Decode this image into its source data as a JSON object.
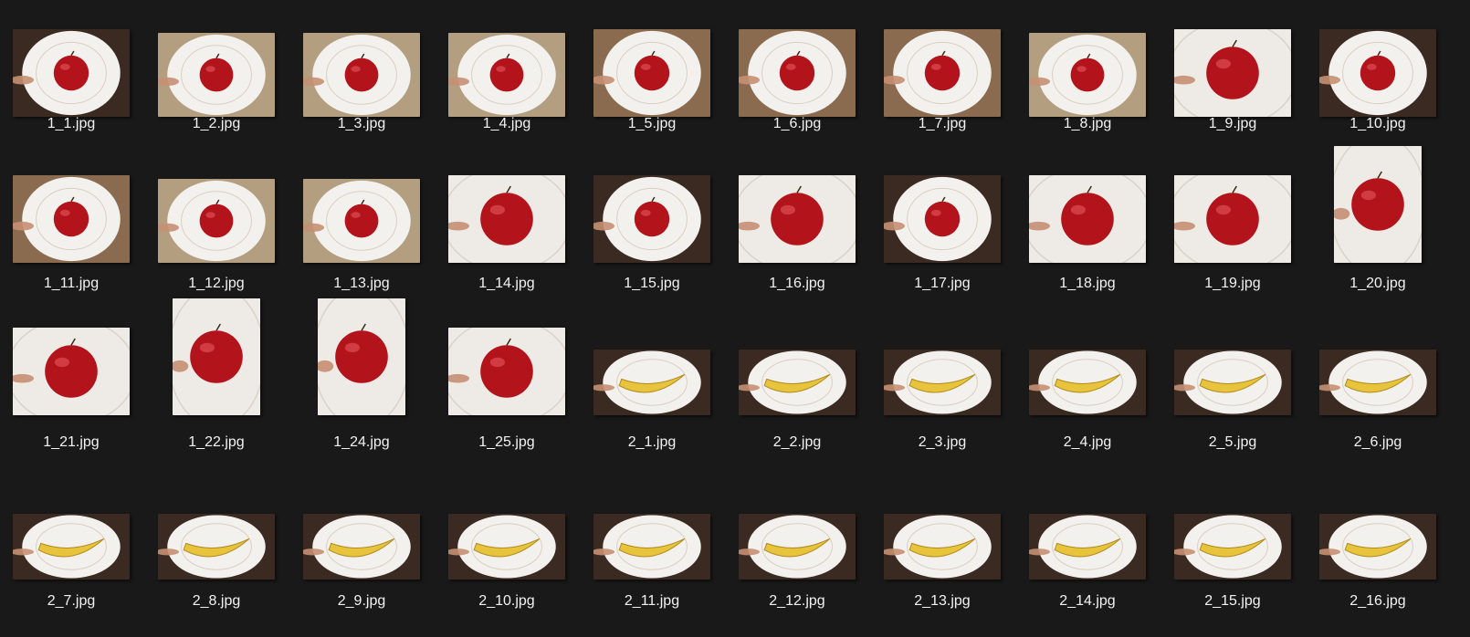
{
  "explorer": {
    "items": [
      {
        "name": "1_1.jpg",
        "subject": "apple",
        "scene": "dark-plate",
        "orientation": "landscape"
      },
      {
        "name": "1_2.jpg",
        "subject": "apple",
        "scene": "plate-on-granite",
        "orientation": "landscape"
      },
      {
        "name": "1_3.jpg",
        "subject": "apple",
        "scene": "plate-on-granite",
        "orientation": "landscape"
      },
      {
        "name": "1_4.jpg",
        "subject": "apple",
        "scene": "plate-on-granite",
        "orientation": "landscape"
      },
      {
        "name": "1_5.jpg",
        "subject": "apple",
        "scene": "plate-on-wood",
        "orientation": "landscape"
      },
      {
        "name": "1_6.jpg",
        "subject": "apple",
        "scene": "plate-on-wood",
        "orientation": "landscape"
      },
      {
        "name": "1_7.jpg",
        "subject": "apple",
        "scene": "plate-on-wood",
        "orientation": "landscape"
      },
      {
        "name": "1_8.jpg",
        "subject": "apple",
        "scene": "plate-on-granite",
        "orientation": "landscape"
      },
      {
        "name": "1_9.jpg",
        "subject": "apple",
        "scene": "plate-close",
        "orientation": "landscape"
      },
      {
        "name": "1_10.jpg",
        "subject": "apple",
        "scene": "dark-plate",
        "orientation": "landscape"
      },
      {
        "name": "1_11.jpg",
        "subject": "apple",
        "scene": "plate-on-wood",
        "orientation": "landscape"
      },
      {
        "name": "1_12.jpg",
        "subject": "apple",
        "scene": "plate-on-granite",
        "orientation": "landscape"
      },
      {
        "name": "1_13.jpg",
        "subject": "apple",
        "scene": "plate-on-granite",
        "orientation": "landscape"
      },
      {
        "name": "1_14.jpg",
        "subject": "apple",
        "scene": "plate-close",
        "orientation": "landscape"
      },
      {
        "name": "1_15.jpg",
        "subject": "apple",
        "scene": "dark-plate",
        "orientation": "landscape"
      },
      {
        "name": "1_16.jpg",
        "subject": "apple",
        "scene": "plate-close",
        "orientation": "landscape"
      },
      {
        "name": "1_17.jpg",
        "subject": "apple",
        "scene": "dark-plate",
        "orientation": "landscape"
      },
      {
        "name": "1_18.jpg",
        "subject": "apple",
        "scene": "plate-close",
        "orientation": "landscape"
      },
      {
        "name": "1_19.jpg",
        "subject": "apple",
        "scene": "plate-close",
        "orientation": "landscape"
      },
      {
        "name": "1_20.jpg",
        "subject": "apple",
        "scene": "plate-close",
        "orientation": "portrait"
      },
      {
        "name": "1_21.jpg",
        "subject": "apple",
        "scene": "plate-close",
        "orientation": "landscape"
      },
      {
        "name": "1_22.jpg",
        "subject": "apple",
        "scene": "plate-close",
        "orientation": "portrait"
      },
      {
        "name": "1_24.jpg",
        "subject": "apple",
        "scene": "plate-close",
        "orientation": "portrait"
      },
      {
        "name": "1_25.jpg",
        "subject": "apple",
        "scene": "plate-close",
        "orientation": "landscape"
      },
      {
        "name": "2_1.jpg",
        "subject": "banana",
        "scene": "dark-plate",
        "orientation": "landscape"
      },
      {
        "name": "2_2.jpg",
        "subject": "banana",
        "scene": "dark-plate",
        "orientation": "landscape"
      },
      {
        "name": "2_3.jpg",
        "subject": "banana",
        "scene": "dark-plate",
        "orientation": "landscape"
      },
      {
        "name": "2_4.jpg",
        "subject": "banana",
        "scene": "dark-plate",
        "orientation": "landscape"
      },
      {
        "name": "2_5.jpg",
        "subject": "banana",
        "scene": "dark-plate",
        "orientation": "landscape"
      },
      {
        "name": "2_6.jpg",
        "subject": "banana",
        "scene": "dark-plate",
        "orientation": "landscape"
      },
      {
        "name": "2_7.jpg",
        "subject": "banana",
        "scene": "dark-plate",
        "orientation": "landscape"
      },
      {
        "name": "2_8.jpg",
        "subject": "banana",
        "scene": "dark-plate",
        "orientation": "landscape"
      },
      {
        "name": "2_9.jpg",
        "subject": "banana",
        "scene": "dark-plate",
        "orientation": "landscape"
      },
      {
        "name": "2_10.jpg",
        "subject": "banana",
        "scene": "dark-plate",
        "orientation": "landscape"
      },
      {
        "name": "2_11.jpg",
        "subject": "banana",
        "scene": "dark-plate",
        "orientation": "landscape"
      },
      {
        "name": "2_12.jpg",
        "subject": "banana",
        "scene": "dark-plate",
        "orientation": "landscape"
      },
      {
        "name": "2_13.jpg",
        "subject": "banana",
        "scene": "dark-plate",
        "orientation": "landscape"
      },
      {
        "name": "2_14.jpg",
        "subject": "banana",
        "scene": "dark-plate",
        "orientation": "landscape"
      },
      {
        "name": "2_15.jpg",
        "subject": "banana",
        "scene": "dark-plate",
        "orientation": "landscape"
      },
      {
        "name": "2_16.jpg",
        "subject": "banana",
        "scene": "dark-plate",
        "orientation": "landscape"
      }
    ]
  },
  "colors": {
    "background": "#191919",
    "label_text": "#f2f2f2",
    "apple": "#b3141b",
    "banana": "#e8c33c",
    "plate": "#f3f1ee",
    "granite": "#b39f80",
    "dark_table": "#3a2a22",
    "skin": "#c58f72"
  }
}
